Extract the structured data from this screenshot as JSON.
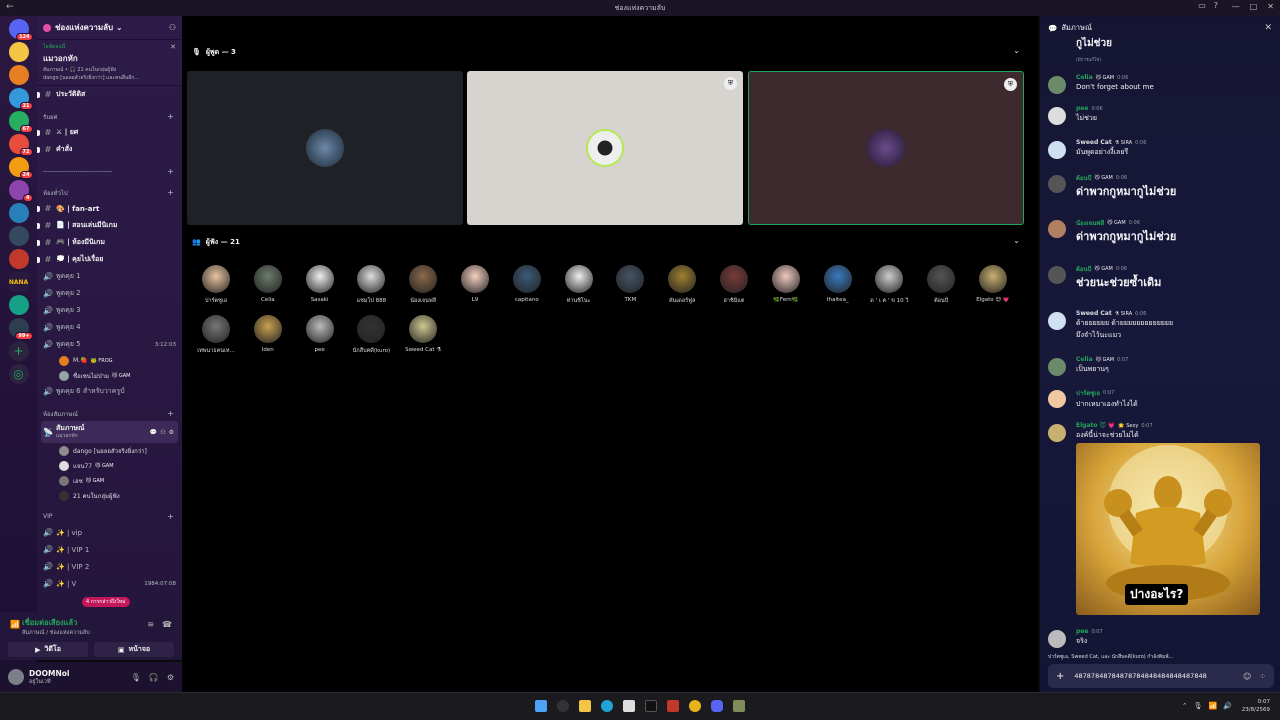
{
  "titlebar": {
    "title": "ช่องแห่งความลับ"
  },
  "servers": [
    {
      "badge": "124"
    },
    {
      "badge": ""
    },
    {
      "badge": ""
    },
    {
      "badge": "31"
    },
    {
      "badge": "67"
    },
    {
      "badge": "72"
    },
    {
      "badge": "24"
    },
    {
      "badge": "4"
    },
    {
      "badge": ""
    },
    {
      "badge": ""
    },
    {
      "badge": ""
    },
    {
      "badge": ""
    },
    {
      "badge": "99+"
    }
  ],
  "server_text": "NANA",
  "guild": {
    "name": "ช่องแห่งความลับ"
  },
  "event": {
    "live": "ไลฟ์ตอนนี้",
    "name": "แมวอกหัก",
    "sub1": "สัมภาษณ์ • 🎧 21 คนในกลุ่มผู้ฟัง",
    "sub2": "dango [นอลอสัวจริงยิ่งกว่า] และคนอื่นอีก..."
  },
  "channels": {
    "top": [
      "ประวัติดิส"
    ],
    "cat_rules": "รับยศ",
    "rules": [
      "⚔ | ยศ",
      "คำสั่ง"
    ],
    "divider": "--------------------------------",
    "cat_general": "ห้องทั่วไป",
    "general": [
      "🎨 | fan-art",
      "📄 | สอนเล่นมีนิเกม",
      "🎮 | ห้องมีนิเกม",
      "💭 | คุยไปเรื่อย"
    ],
    "voice": [
      "พูดคุย 1",
      "พูดคุย 2",
      "พูดคุย 3",
      "พูดคุย 4",
      "พูดคุย 5"
    ],
    "voice5_time": "3:12:03",
    "voice5_users": [
      {
        "name": "M.🍓",
        "tag": "🐸 FROG"
      },
      {
        "name": "ชื่อเซนไม่ป่าม",
        "tag": "😼 GAM"
      }
    ],
    "voice6": "พูดคุย 6 สำหรับวาครูป์",
    "cat_stage": "ห้องสัมภาษณ์",
    "stage_name": "สัมภาษณ์",
    "stage_sub": "แมวอกหัก",
    "stage_users": [
      {
        "name": "dango [นอลอสัวจริงยิ่งกว่า]",
        "tag": ""
      },
      {
        "name": "แจน77",
        "tag": "😼 GAM"
      },
      {
        "name": "เฮซ",
        "tag": "😼 GAM"
      },
      {
        "name": "21 คนในกลุ่มผู้ฟัง",
        "tag": ""
      }
    ],
    "cat_vip": "VIP",
    "vip": [
      "✨ | vip",
      "✨ | VIP 1",
      "✨ | VIP 2",
      "✨ | V"
    ],
    "vip_time": "1984:07:08",
    "live_chip": "4 การกล่าวถึงใหม่"
  },
  "voicepanel": {
    "status": "เชื่อมต่อเสียงแล้ว",
    "path": "สัมภาษณ์ / ช่องแห่งความลับ",
    "video": "วิดีโอ",
    "screen": "หน้าจอ"
  },
  "user": {
    "name": "DOOMNol",
    "status": "อยู่ในเวที"
  },
  "stage": {
    "speakers_label": "ผู้พูด — 3",
    "listeners_label": "ผู้ฟัง — 21",
    "listeners": [
      "ปาร์ตซูเอ",
      "Celia",
      "Sasaki",
      "แชมโป 888",
      "น้องเจนฟลี",
      "L9",
      "capitano",
      "ท่านชิโนะ",
      "TKM",
      "คันเดอร์ฟูล",
      "ฮาชิมิแต",
      "🌿Fern🌿",
      "thaitea_",
      "ด ' เ ค ' ข 10 วิ",
      "ต้อนบี",
      "Elgato 😈 💗",
      "เทพนาธคนเห...",
      "Iden",
      "pee",
      "นักสืบคดี(kuro)",
      "Sweed Cat ⚗"
    ]
  },
  "chat": {
    "title": "สัมภาษณ์",
    "top_cut": "กูไม่ช่วย",
    "top_edited": "(มีการแก้ไข)",
    "messages": [
      {
        "author": "Celia",
        "badge": "😼 GAM",
        "time": "0:06",
        "text": "Don't forget about me",
        "color": "#23a55a"
      },
      {
        "author": "pee",
        "badge": "",
        "time": "0:06",
        "text": "ไม่ช่วย",
        "color": "#23a55a"
      },
      {
        "author": "Sweed Cat",
        "badge": "⚗ SIRA",
        "time": "0:06",
        "text": "มันพูดอย่างงี้เลยรึ",
        "color": "#dbdee1"
      },
      {
        "author": "ต้อนบี",
        "badge": "😼 GAM",
        "time": "0:06",
        "text": "ด่าพวกกูหมากูไม่ช่วย",
        "color": "#23a55a"
      },
      {
        "author": "น้องเจนฟลี",
        "badge": "😼 GAM",
        "time": "0:06",
        "text": "ด่าพวกกูหมากูไม่ช่วย",
        "color": "#23a55a"
      },
      {
        "author": "ต้อนบี",
        "badge": "😼 GAM",
        "time": "0:06",
        "text": "ช่วยนะช่วยซ้ำเดิม",
        "color": "#23a55a"
      },
      {
        "author": "Sweed Cat",
        "badge": "⚗ SIRA",
        "time": "0:06",
        "text": "ด้ายยยยยย ด้ายยยยยยยยยยยยย",
        "text2": "มึงจำไว้นะแมว",
        "color": "#dbdee1"
      },
      {
        "author": "Celia",
        "badge": "😼 GAM",
        "time": "0:07",
        "text": "เป็นพยานๆ",
        "color": "#23a55a"
      },
      {
        "author": "ปาร์ตซูเอ",
        "badge": "",
        "time": "0:07",
        "text": "ปากเหมาเองทำไงได้",
        "color": "#23a55a"
      },
      {
        "author": "Elgato 😈 💗",
        "badge": "🌟 Sexy",
        "time": "0:07",
        "text": "องค์นี้น่าจะช่วยไม่ได้",
        "color": "#23a55a"
      },
      {
        "author": "pee",
        "badge": "",
        "time": "0:07",
        "text": "จริง",
        "color": "#23a55a"
      }
    ],
    "image_caption": "ปางอะไร?",
    "typing": "ปาร์ตซูเอ, Sweed Cat, และ นักสืบคดี(kuro) กำลังพิมพ์...",
    "input_value": "48787848784878784848484848487848"
  },
  "taskbar": {
    "time": "0:07",
    "date": "23/8/2569"
  }
}
